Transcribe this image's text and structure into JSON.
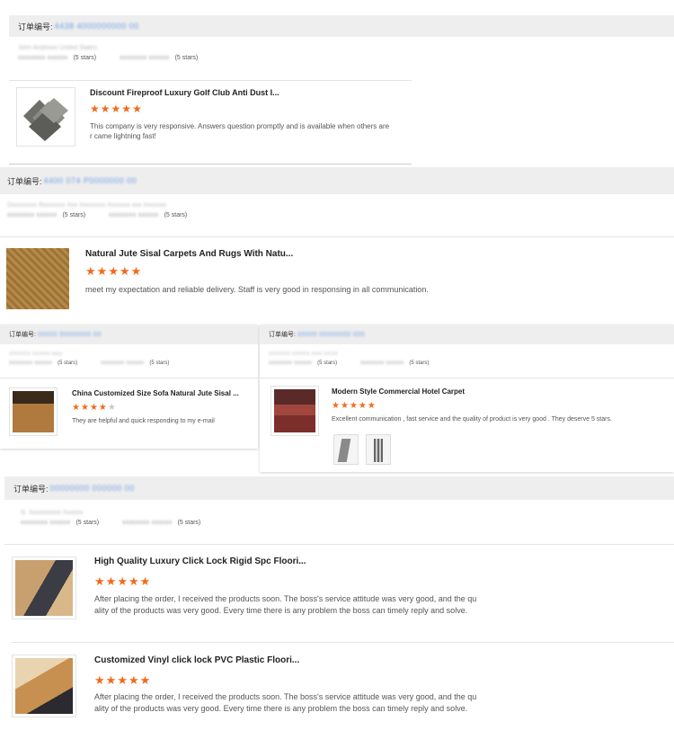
{
  "order_label": "订单编号:",
  "colors": {
    "star": "#f26a1b",
    "bar": "#eeeeee",
    "order_id": "#6f9ee6"
  },
  "icons": {
    "star": "star-icon"
  },
  "reviews": [
    {
      "order_id": "4438 4000000000 00",
      "country": "John Andrews United States",
      "r1_name": "xxxxxxxx xxxxxx",
      "r1_stars": "(5 stars)",
      "r2_name": "xxxxxxxx xxxxxx",
      "r2_stars": "(5 stars)",
      "items": [
        {
          "title": "Discount Fireproof Luxury Golf Club Anti Dust I...",
          "rating": 5,
          "text": "This company is very responsive. Answers question promptly and is available when others are\nr came lightning fast!"
        }
      ]
    },
    {
      "order_id": "4400 074 P0000000 00",
      "country": "Dxxxxxxxx Rxxxxxxx Xxx Xxxxxxxx Xxxxxxx xxx Xxxxxxx",
      "r1_name": "xxxxxxxx xxxxxx",
      "r1_stars": "(5 stars)",
      "r2_name": "xxxxxxxx xxxxxx",
      "r2_stars": "(5 stars)",
      "items": [
        {
          "title": "Natural Jute Sisal Carpets And Rugs With Natu...",
          "rating": 5,
          "text": "meet my expectation and reliable delivery. Staff is very good in responsing in all communication."
        }
      ]
    },
    {
      "order_id": "00000 00000000 00",
      "country": "XXXXXX XXXXX xxxx",
      "r1_name": "xxxxxxxx xxxxxx",
      "r1_stars": "(5 stars)",
      "r2_name": "xxxxxxxx xxxxxx",
      "r2_stars": "(5 stars)",
      "items": [
        {
          "title": "China Customized Size Sofa Natural Jute Sisal ...",
          "rating": 4,
          "text": "They are helpful and quick responding to my e-mail"
        }
      ]
    },
    {
      "order_id": "00000 00000000 000",
      "country": "XXXXXX XXXXX XXX XXXX",
      "r1_name": "xxxxxxxx xxxxxx",
      "r1_stars": "(5 stars)",
      "r2_name": "xxxxxxxx xxxxxx",
      "r2_stars": "(5 stars)",
      "items": [
        {
          "title": "Modern Style Commercial Hotel Carpet",
          "rating": 5,
          "text": "Excellent communication , fast service and the quality of product is very good . They deserve 5 stars."
        }
      ]
    },
    {
      "order_id": "00000000 000000 00",
      "country": "N. Xxxxxxxxxx Xxxxxx",
      "r1_name": "xxxxxxxx xxxxxx",
      "r1_stars": "(5 stars)",
      "r2_name": "xxxxxxxx xxxxxx",
      "r2_stars": "(5 stars)",
      "items": [
        {
          "title": "High Quality Luxury Click Lock Rigid Spc Floori...",
          "rating": 5,
          "text": "After placing the order, I received the products soon. The boss's service attitude was very good, and the qu\nality of the products was very good. Every time there is any problem the boss can timely reply and solve."
        },
        {
          "title": "Customized Vinyl click lock PVC Plastic Floori...",
          "rating": 5,
          "text": "After placing the order, I received the products soon. The boss's service attitude was very good, and the qu\nality of the products was very good. Every time there is any problem the boss can timely reply and solve."
        }
      ]
    }
  ]
}
